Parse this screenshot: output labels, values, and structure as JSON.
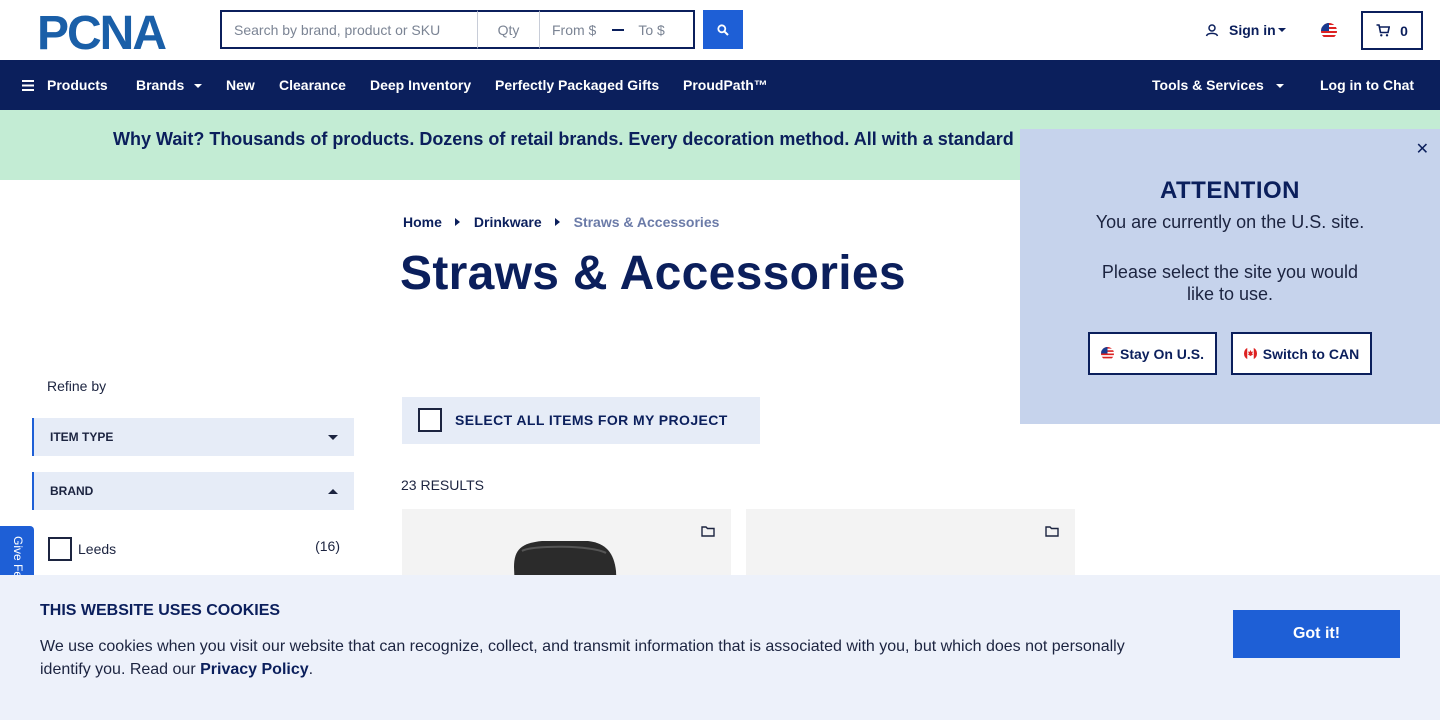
{
  "header": {
    "logo_text": "PCNA",
    "search_placeholder": "Search by brand, product or SKU",
    "qty_placeholder": "Qty",
    "price_from_placeholder": "From $",
    "price_to_placeholder": "To $",
    "signin_label": "Sign in",
    "cart_count": "0",
    "icons": [
      "search-icon",
      "user-icon",
      "flag-us-icon",
      "cart-icon"
    ]
  },
  "nav": {
    "items": [
      {
        "label": "Products"
      },
      {
        "label": "Brands"
      },
      {
        "label": "New"
      },
      {
        "label": "Clearance"
      },
      {
        "label": "Deep Inventory"
      },
      {
        "label": "Perfectly Packaged Gifts"
      },
      {
        "label": "ProudPath™"
      }
    ],
    "tools_label": "Tools & Services",
    "chat_label": "Log in to Chat"
  },
  "promo": {
    "text": "Why Wait? Thousands of products. Dozens of retail brands. Every decoration method. All with a standard"
  },
  "breadcrumb": {
    "items": [
      "Home",
      "Drinkware",
      "Straws & Accessories"
    ]
  },
  "page": {
    "title": "Straws & Accessories"
  },
  "sidebar": {
    "refine_label": "Refine by",
    "filters": [
      {
        "label": "ITEM TYPE",
        "state": "collapsed"
      },
      {
        "label": "BRAND",
        "state": "expanded"
      }
    ],
    "brand_options": [
      {
        "label": "Leeds",
        "count": "(16)"
      }
    ],
    "feedback_label": "Give Feedback"
  },
  "results": {
    "select_all_label": "SELECT ALL ITEMS FOR MY PROJECT",
    "count_label": "23 RESULTS"
  },
  "attention": {
    "title": "ATTENTION",
    "line1": "You are currently on the U.S. site.",
    "line2": "Please select the site you would like to use.",
    "stay_label": "Stay On U.S.",
    "switch_label": "Switch to CAN",
    "close_glyph": "✕"
  },
  "cookie": {
    "title": "THIS WEBSITE USES COOKIES",
    "text": "We use cookies when you visit our website that can recognize, collect, and transmit information that is associated with you, but which does not personally identify you. Read our",
    "link": "Privacy Policy",
    "period": ".",
    "button": "Got it!"
  },
  "colors": {
    "navy": "#0b1f5c",
    "accent_blue": "#1e5fd6",
    "promo_green": "#c3ecd4",
    "popup_bg": "#c6d3ec",
    "cookie_bg": "#edf1fa"
  }
}
